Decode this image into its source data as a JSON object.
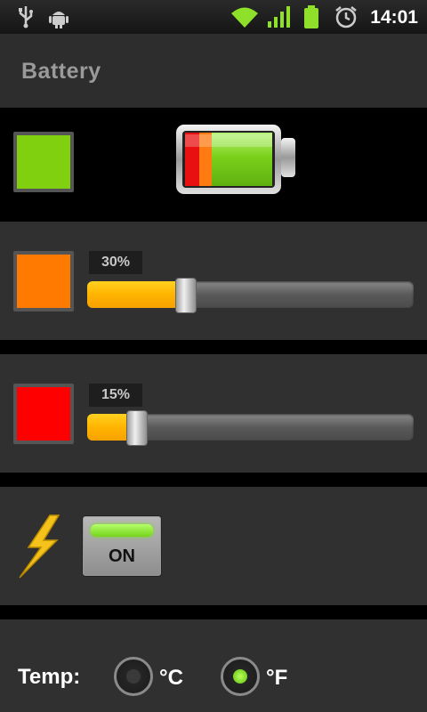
{
  "status_bar": {
    "clock": "14:01",
    "icons": [
      "usb-icon",
      "android-debug-icon",
      "wifi-icon",
      "signal-icon",
      "battery-icon",
      "alarm-icon"
    ]
  },
  "header": {
    "title": "Battery"
  },
  "full_level": {
    "color": "#80d010"
  },
  "warning_level": {
    "color": "#ff7a00",
    "percent_label": "30%",
    "value": 30
  },
  "critical_level": {
    "color": "#ff0000",
    "percent_label": "15%",
    "value": 15
  },
  "charging": {
    "icon": "lightning-bolt-icon",
    "toggle_label": "ON",
    "state": "on"
  },
  "temperature": {
    "label": "Temp:",
    "options": [
      {
        "label": "°C",
        "selected": false
      },
      {
        "label": "°F",
        "selected": true
      }
    ]
  }
}
